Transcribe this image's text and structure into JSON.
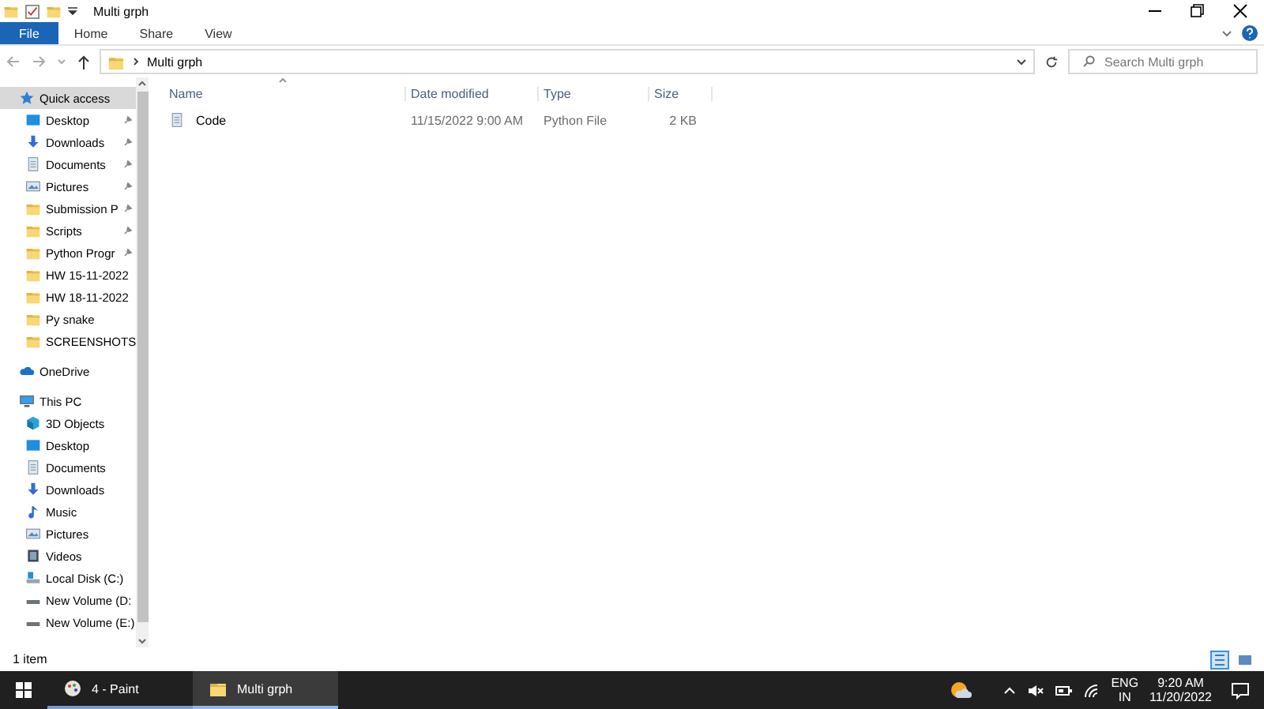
{
  "window": {
    "title": "Multi grph"
  },
  "ribbon_tabs": [
    {
      "label": "File",
      "selected": true
    },
    {
      "label": "Home",
      "selected": false
    },
    {
      "label": "Share",
      "selected": false
    },
    {
      "label": "View",
      "selected": false
    }
  ],
  "address": {
    "path": "Multi grph",
    "search_placeholder": "Search Multi grph"
  },
  "sidebar": [
    {
      "label": "Quick access",
      "kind": "star",
      "selected": true,
      "children": [
        {
          "label": "Desktop",
          "kind": "desktop",
          "pinned": true
        },
        {
          "label": "Downloads",
          "kind": "downloads",
          "pinned": true
        },
        {
          "label": "Documents",
          "kind": "documents",
          "pinned": true
        },
        {
          "label": "Pictures",
          "kind": "pictures",
          "pinned": true
        },
        {
          "label": "Submission P",
          "kind": "folder",
          "pinned": true
        },
        {
          "label": "Scripts",
          "kind": "folder",
          "pinned": true
        },
        {
          "label": "Python Progr",
          "kind": "folder",
          "pinned": true
        },
        {
          "label": "HW 15-11-2022",
          "kind": "folder",
          "pinned": false
        },
        {
          "label": "HW 18-11-2022",
          "kind": "folder",
          "pinned": false
        },
        {
          "label": "Py snake",
          "kind": "folder",
          "pinned": false
        },
        {
          "label": "SCREENSHOTS",
          "kind": "folder",
          "pinned": false
        }
      ]
    },
    {
      "label": "OneDrive",
      "kind": "cloud",
      "selected": false
    },
    {
      "label": "This PC",
      "kind": "pc",
      "selected": false,
      "children": [
        {
          "label": "3D Objects",
          "kind": "objects3d"
        },
        {
          "label": "Desktop",
          "kind": "desktop"
        },
        {
          "label": "Documents",
          "kind": "documents"
        },
        {
          "label": "Downloads",
          "kind": "downloads"
        },
        {
          "label": "Music",
          "kind": "music"
        },
        {
          "label": "Pictures",
          "kind": "pictures"
        },
        {
          "label": "Videos",
          "kind": "videos"
        },
        {
          "label": "Local Disk (C:)",
          "kind": "disk"
        },
        {
          "label": "New Volume (D:",
          "kind": "drive"
        },
        {
          "label": "New Volume (E:)",
          "kind": "drive"
        }
      ]
    }
  ],
  "file_list": {
    "columns": [
      "Name",
      "Date modified",
      "Type",
      "Size"
    ],
    "rows": [
      {
        "name": "Code",
        "date_modified": "11/15/2022 9:00 AM",
        "type": "Python File",
        "size": "2 KB"
      }
    ]
  },
  "status_bar": {
    "item_count": "1 item"
  },
  "taskbar": {
    "apps": [
      {
        "label": "4 - Paint",
        "kind": "paint",
        "selected": false
      },
      {
        "label": "Multi grph",
        "kind": "folder",
        "selected": true
      }
    ],
    "language": "ENG",
    "region": "IN",
    "time": "9:20 AM",
    "date": "11/20/2022"
  }
}
